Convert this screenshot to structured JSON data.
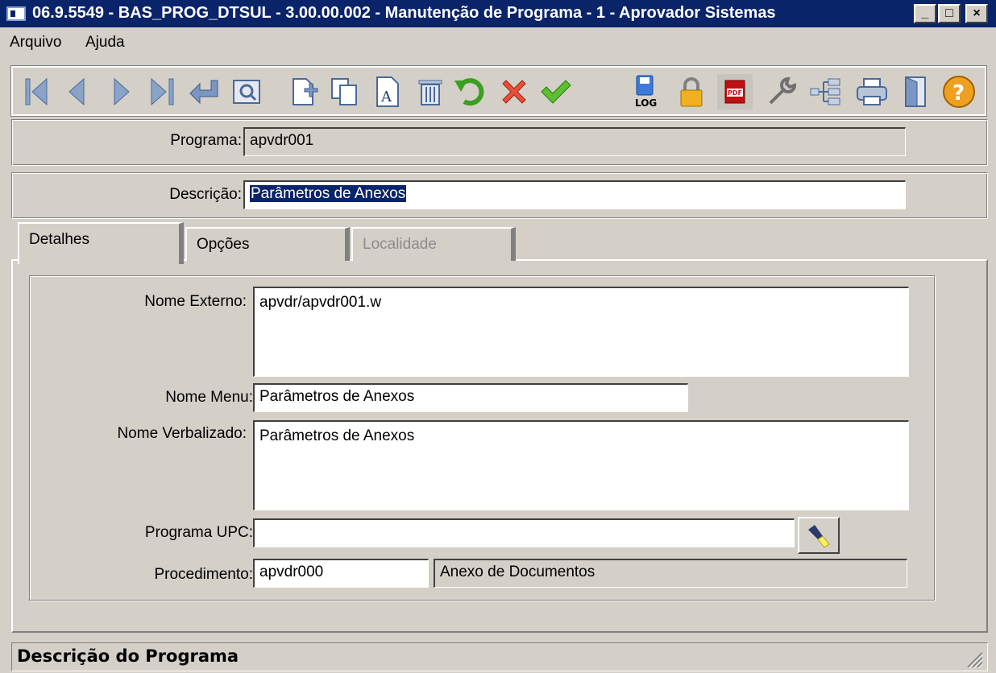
{
  "window": {
    "title": "06.9.5549 - BAS_PROG_DTSUL - 3.00.00.002 - Manutenção de Programa - 1 - Aprovador Sistemas",
    "min_glyph": "_",
    "max_glyph": "□",
    "close_glyph": "×"
  },
  "menu": {
    "items": [
      {
        "label": "Arquivo"
      },
      {
        "label": "Ajuda"
      }
    ]
  },
  "toolbar": {
    "log_label": "LOG",
    "pdf_label": "PDF",
    "buttons": [
      "first-icon",
      "previous-icon",
      "next-icon",
      "last-icon",
      "goto-icon",
      "search-icon",
      "new-icon",
      "copy-icon",
      "edit-icon",
      "delete-icon",
      "undo-icon",
      "cancel-icon",
      "confirm-icon",
      "log-icon",
      "lock-icon",
      "pdf-icon",
      "tools-icon",
      "tree-icon",
      "print-icon",
      "exit-icon",
      "help-icon"
    ]
  },
  "header": {
    "programa_label": "Programa:",
    "programa_value": "apvdr001",
    "descricao_label": "Descrição:",
    "descricao_value": "Parâmetros de Anexos"
  },
  "tabs": [
    {
      "label": "Detalhes",
      "active": true,
      "enabled": true
    },
    {
      "label": "Opções",
      "active": false,
      "enabled": true
    },
    {
      "label": "Localidade",
      "active": false,
      "enabled": false
    }
  ],
  "details": {
    "nome_externo_label": "Nome Externo:",
    "nome_externo_value": "apvdr/apvdr001.w",
    "nome_menu_label": "Nome Menu:",
    "nome_menu_value": "Parâmetros de Anexos",
    "nome_verbalizado_label": "Nome Verbalizado:",
    "nome_verbalizado_value": "Parâmetros de Anexos",
    "programa_upc_label": "Programa UPC:",
    "programa_upc_value": "",
    "procedimento_label": "Procedimento:",
    "procedimento_value": "apvdr000",
    "procedimento_desc": "Anexo de Documentos"
  },
  "status": {
    "text": "Descrição do Programa"
  }
}
